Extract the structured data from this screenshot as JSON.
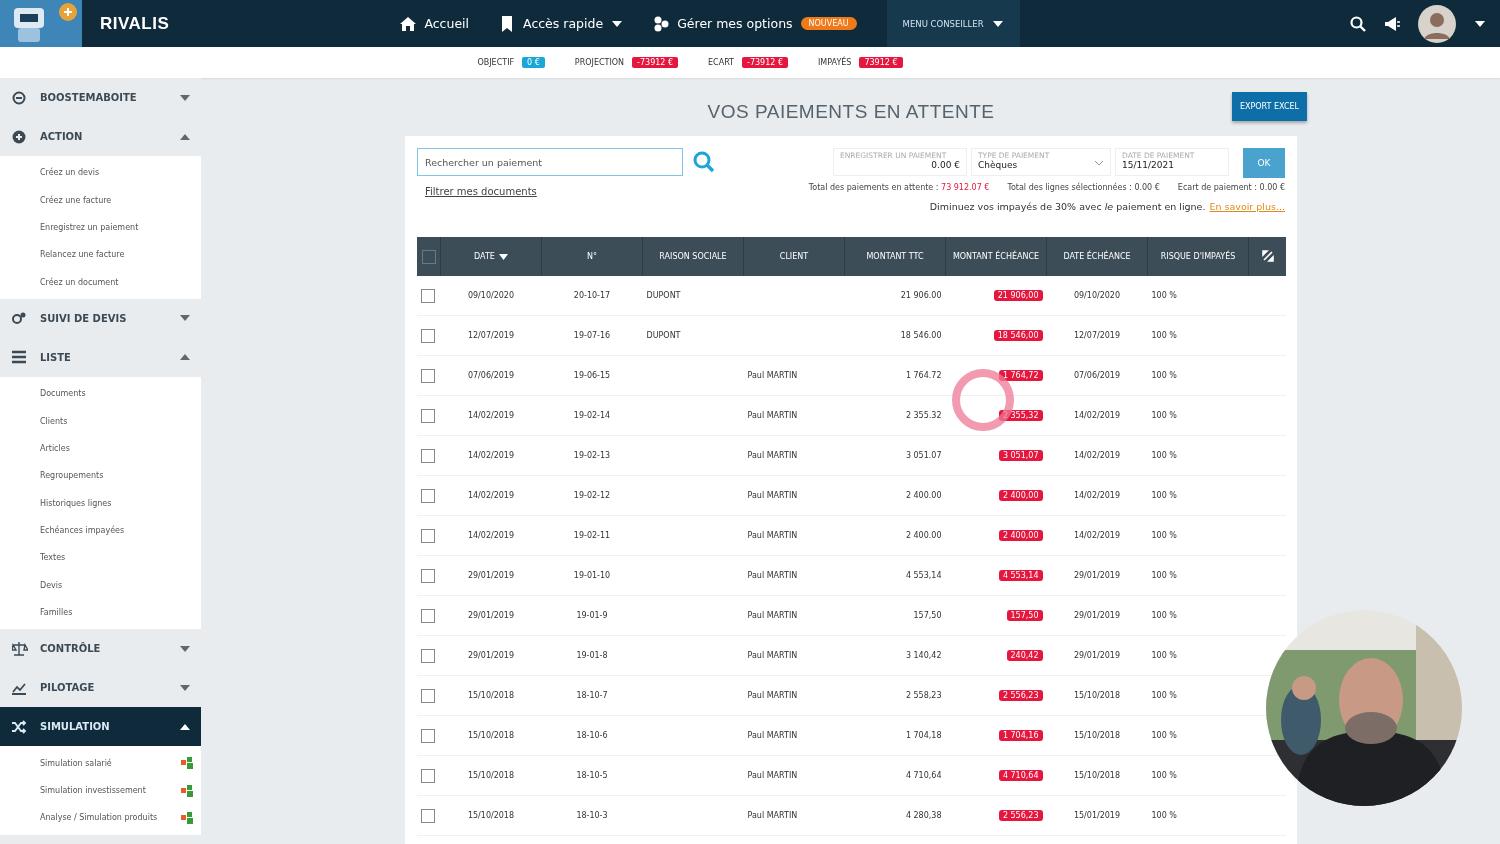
{
  "topbar": {
    "brand": "RIVALIS",
    "nav": [
      {
        "label": "Accueil",
        "kind": "home"
      },
      {
        "label": "Accès rapide",
        "kind": "bookmark",
        "dropdown": true
      },
      {
        "label": "Gérer mes options",
        "kind": "options",
        "badge": "NOUVEAU"
      }
    ],
    "menu": {
      "label": "MENU CONSEILLER",
      "selected": true
    }
  },
  "stats": [
    {
      "label": "OBJECTIF",
      "value": "0 €",
      "color": "#1aa7d8"
    },
    {
      "label": "PROJECTION",
      "value": "-73912 €",
      "color": "#e5173f"
    },
    {
      "label": "ECART",
      "value": "-73912 €",
      "color": "#e5173f"
    },
    {
      "label": "IMPAYÉS",
      "value": "73912 €",
      "color": "#e5173f"
    }
  ],
  "sidebar": {
    "sections": [
      {
        "label": "BOOSTEMABOITE",
        "expanded": false,
        "selected": false
      },
      {
        "label": "ACTION",
        "expanded": true,
        "selected": false,
        "children": [
          {
            "label": "Créez un devis"
          },
          {
            "label": "Créez une facture"
          },
          {
            "label": "Enregistrez un paiement"
          },
          {
            "label": "Relancez une facture"
          },
          {
            "label": "Créez un document"
          }
        ]
      },
      {
        "label": "SUIVI DE DEVIS",
        "expanded": false,
        "selected": false
      },
      {
        "label": "LISTE",
        "expanded": true,
        "selected": false,
        "children": [
          {
            "label": "Documents"
          },
          {
            "label": "Clients"
          },
          {
            "label": "Articles"
          },
          {
            "label": "Regroupements"
          },
          {
            "label": "Historiques lignes"
          },
          {
            "label": "Echéances impayées"
          },
          {
            "label": "Textes"
          },
          {
            "label": "Devis"
          },
          {
            "label": "Familles"
          }
        ]
      },
      {
        "label": "CONTRÔLE",
        "expanded": false,
        "selected": false
      },
      {
        "label": "PILOTAGE",
        "expanded": false,
        "selected": false
      },
      {
        "label": "SIMULATION",
        "expanded": true,
        "selected": true,
        "children": [
          {
            "label": "Simulation salarié",
            "tagged": true
          },
          {
            "label": "Simulation investissement",
            "tagged": true
          },
          {
            "label": "Analyse / Simulation produits",
            "tagged": true
          }
        ]
      }
    ]
  },
  "page": {
    "title": "VOS PAIEMENTS EN ATTENTE",
    "export_button": "EXPORT EXCEL"
  },
  "search": {
    "placeholder": "Rechercher un paiement"
  },
  "filter_link": "Filtrer mes documents",
  "payment_form": {
    "amount": {
      "label": "ENREGISTRER UN PAIEMENT",
      "value": "0.00 €"
    },
    "type": {
      "label": "TYPE DE PAIEMENT",
      "value": "Chèques"
    },
    "date": {
      "label": "DATE DE PAIEMENT",
      "value": "15/11/2021"
    },
    "ok_button": "OK"
  },
  "totals": [
    {
      "label": "Total des paiements en attente : ",
      "value": "73 912.07 €",
      "alert": true
    },
    {
      "label": "Total des lignes sélectionnées : ",
      "value": "0.00 €",
      "alert": false
    },
    {
      "label": "Ecart de paiement : ",
      "value": "0.00 €",
      "alert": false
    }
  ],
  "promo": {
    "text": "Diminuez vos impayés de 30% avec *le* paiement en ligne.",
    "link": "En savoir plus..."
  },
  "table": {
    "select_all_checked": false,
    "columns": [
      {
        "label": "DATE",
        "sorted": true
      },
      {
        "label": "N°",
        "sorted": false
      },
      {
        "label": "RAISON SOCIALE",
        "sorted": false
      },
      {
        "label": "CLIENT",
        "sorted": false
      },
      {
        "label": "MONTANT TTC",
        "sorted": false
      },
      {
        "label": "MONTANT ÉCHÉANCE",
        "sorted": false
      },
      {
        "label": "DATE ÉCHÉANCE",
        "sorted": false
      },
      {
        "label": "RISQUE D'IMPAYÉS",
        "sorted": false
      }
    ],
    "rows": [
      {
        "checked": false,
        "date": "09/10/2020",
        "number": "20-10-17",
        "company": "DUPONT",
        "client": "",
        "amount": "21 906.00",
        "due_amount": "21 906,00",
        "due_date": "09/10/2020",
        "risk": "100 %"
      },
      {
        "checked": false,
        "date": "12/07/2019",
        "number": "19-07-16",
        "company": "DUPONT",
        "client": "",
        "amount": "18 546.00",
        "due_amount": "18 546,00",
        "due_date": "12/07/2019",
        "risk": "100 %"
      },
      {
        "checked": false,
        "date": "07/06/2019",
        "number": "19-06-15",
        "company": "",
        "client": "Paul MARTIN",
        "amount": "1 764.72",
        "due_amount": "1 764,72",
        "due_date": "07/06/2019",
        "risk": "100 %"
      },
      {
        "checked": false,
        "date": "14/02/2019",
        "number": "19-02-14",
        "company": "",
        "client": "Paul MARTIN",
        "amount": "2 355.32",
        "due_amount": "2 355,32",
        "due_date": "14/02/2019",
        "risk": "100 %"
      },
      {
        "checked": false,
        "date": "14/02/2019",
        "number": "19-02-13",
        "company": "",
        "client": "Paul MARTIN",
        "amount": "3 051.07",
        "due_amount": "3 051,07",
        "due_date": "14/02/2019",
        "risk": "100 %"
      },
      {
        "checked": false,
        "date": "14/02/2019",
        "number": "19-02-12",
        "company": "",
        "client": "Paul MARTIN",
        "amount": "2 400.00",
        "due_amount": "2 400,00",
        "due_date": "14/02/2019",
        "risk": "100 %"
      },
      {
        "checked": false,
        "date": "14/02/2019",
        "number": "19-02-11",
        "company": "",
        "client": "Paul MARTIN",
        "amount": "2 400.00",
        "due_amount": "2 400,00",
        "due_date": "14/02/2019",
        "risk": "100 %"
      },
      {
        "checked": false,
        "date": "29/01/2019",
        "number": "19-01-10",
        "company": "",
        "client": "Paul MARTIN",
        "amount": "4 553,14",
        "due_amount": "4 553,14",
        "due_date": "29/01/2019",
        "risk": "100 %"
      },
      {
        "checked": false,
        "date": "29/01/2019",
        "number": "19-01-9",
        "company": "",
        "client": "Paul MARTIN",
        "amount": "157,50",
        "due_amount": "157,50",
        "due_date": "29/01/2019",
        "risk": "100 %"
      },
      {
        "checked": false,
        "date": "29/01/2019",
        "number": "19-01-8",
        "company": "",
        "client": "Paul MARTIN",
        "amount": "3 140,42",
        "due_amount": "240,42",
        "due_date": "29/01/2019",
        "risk": "100 %"
      },
      {
        "checked": false,
        "date": "15/10/2018",
        "number": "18-10-7",
        "company": "",
        "client": "Paul MARTIN",
        "amount": "2 558,23",
        "due_amount": "2 556,23",
        "due_date": "15/10/2018",
        "risk": "100 %"
      },
      {
        "checked": false,
        "date": "15/10/2018",
        "number": "18-10-6",
        "company": "",
        "client": "Paul MARTIN",
        "amount": "1 704,18",
        "due_amount": "1 704,16",
        "due_date": "15/10/2018",
        "risk": "100 %"
      },
      {
        "checked": false,
        "date": "15/10/2018",
        "number": "18-10-5",
        "company": "",
        "client": "Paul MARTIN",
        "amount": "4 710,64",
        "due_amount": "4 710,64",
        "due_date": "15/10/2018",
        "risk": "100 %"
      },
      {
        "checked": false,
        "date": "15/10/2018",
        "number": "18-10-3",
        "company": "",
        "client": "Paul MARTIN",
        "amount": "4 280,38",
        "due_amount": "2 556,23",
        "due_date": "15/01/2019",
        "risk": "100 %"
      }
    ]
  }
}
